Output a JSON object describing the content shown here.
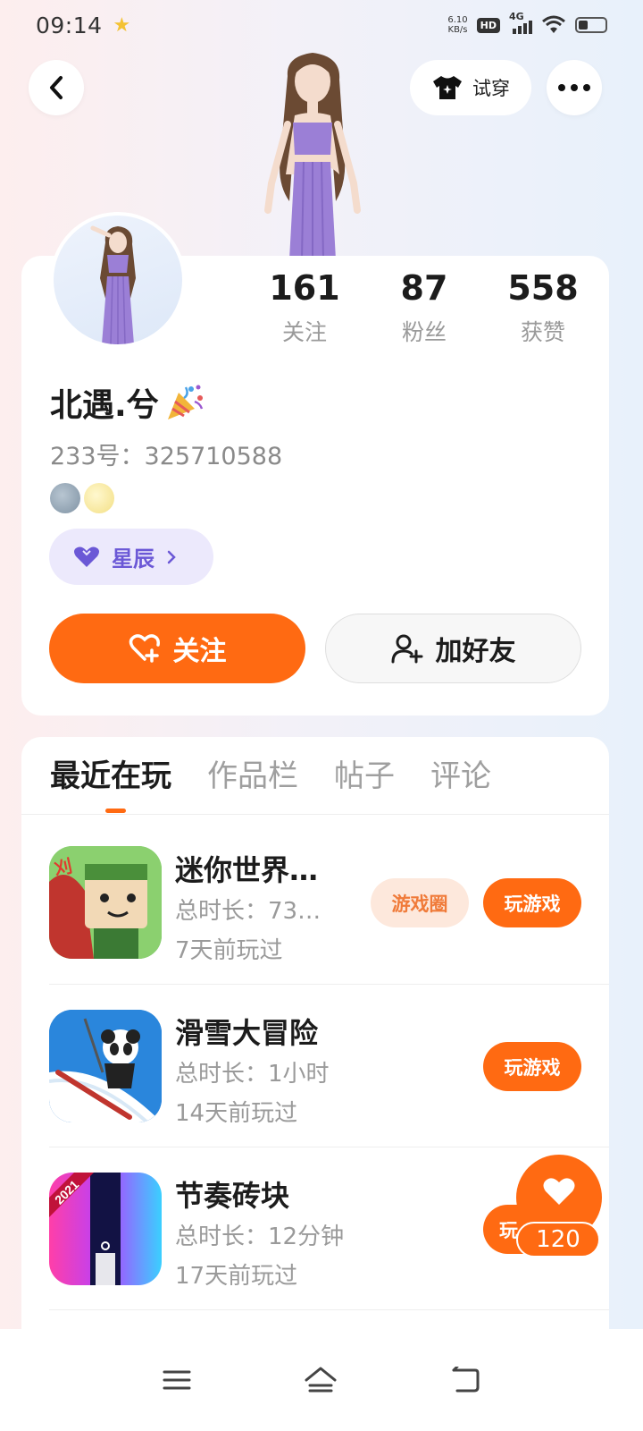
{
  "status_bar": {
    "time": "09:14",
    "net_speed_value": "6.10",
    "net_speed_unit": "KB/s",
    "hd": "HD",
    "network": "4G"
  },
  "header": {
    "try_on_label": "试穿"
  },
  "stats": [
    {
      "value": "161",
      "label": "关注"
    },
    {
      "value": "87",
      "label": "粉丝"
    },
    {
      "value": "558",
      "label": "获赞"
    }
  ],
  "profile": {
    "username": "北遇.兮",
    "user_id": "233号：325710588",
    "star_tag": "星辰",
    "follow_label": "关注",
    "add_friend_label": "加好友"
  },
  "tabs": [
    "最近在玩",
    "作品栏",
    "帖子",
    "评论"
  ],
  "games": [
    {
      "title": "迷你世界…",
      "duration": "总时长：73…",
      "last_played": "7天前玩过",
      "circle_label": "游戏圈",
      "play_label": "玩游戏"
    },
    {
      "title": "滑雪大冒险",
      "duration": "总时长：1小时",
      "last_played": "14天前玩过",
      "play_label": "玩游戏"
    },
    {
      "title": "节奏砖块",
      "duration": "总时长：12分钟",
      "last_played": "17天前玩过",
      "play_label": "玩",
      "icon_year": "2021"
    }
  ],
  "like": {
    "count": "120"
  },
  "colors": {
    "accent": "#ff6a12",
    "star_tag_text": "#6b58d6",
    "star_tag_bg": "#ece9fc"
  }
}
